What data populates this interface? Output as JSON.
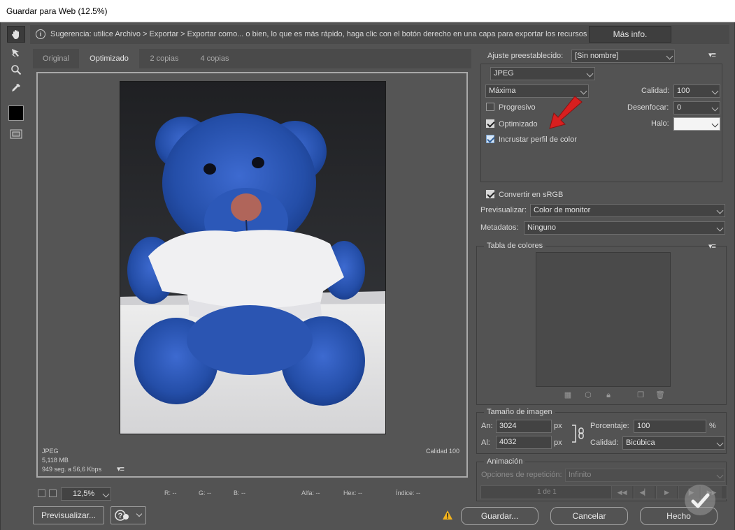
{
  "window": {
    "title": "Guardar para Web (12.5%)"
  },
  "hint": {
    "icon": "info-icon",
    "text": "Sugerencia: utilice Archivo > Exportar > Exportar como... o bien, lo que es más rápido, haga clic con el botón derecho en una capa para exportar los recursos",
    "more_info": "Más info."
  },
  "tools": [
    "hand-icon",
    "slice-select-icon",
    "zoom-icon",
    "eyedropper-icon",
    "color-swatch",
    "toggle-slices-icon"
  ],
  "tabs": [
    {
      "label": "Original",
      "active": false
    },
    {
      "label": "Optimizado",
      "active": true
    },
    {
      "label": "2 copias",
      "active": false
    },
    {
      "label": "4 copias",
      "active": false
    }
  ],
  "preview_info": {
    "format": "JPEG",
    "size": "5,118 MB",
    "time": "949 seg. a 56,6 Kbps",
    "quality": "Calidad 100"
  },
  "status": {
    "zoom": "12,5%",
    "r": "R: --",
    "g": "G: --",
    "b": "B: --",
    "alpha": "Alfa: --",
    "hex": "Hex: --",
    "index": "Índice: --"
  },
  "settings": {
    "preset_label": "Ajuste preestablecido:",
    "preset_value": "[Sin nombre]",
    "format": "JPEG",
    "quality_preset": "Máxima",
    "quality_label": "Calidad:",
    "quality_value": "100",
    "blur_label": "Desenfocar:",
    "blur_value": "0",
    "matte_label": "Halo:",
    "progressive": {
      "label": "Progresivo",
      "checked": false
    },
    "optimized": {
      "label": "Optimizado",
      "checked": true
    },
    "embed_profile": {
      "label": "Incrustar perfil de color",
      "checked": true
    },
    "convert_srgb": {
      "label": "Convertir en sRGB",
      "checked": true
    },
    "preview_label": "Previsualizar:",
    "preview_value": "Color de monitor",
    "metadata_label": "Metadatos:",
    "metadata_value": "Ninguno"
  },
  "color_table": {
    "title": "Tabla de colores"
  },
  "image_size": {
    "title": "Tamaño de imagen",
    "w_label": "An:",
    "w_value": "3024",
    "h_label": "Al:",
    "h_value": "4032",
    "unit": "px",
    "percent_label": "Porcentaje:",
    "percent_value": "100",
    "percent_unit": "%",
    "quality_label": "Calidad:",
    "quality_value": "Bicúbica"
  },
  "animation": {
    "title": "Animación",
    "loop_label": "Opciones de repetición:",
    "loop_value": "Infinito",
    "frame_counter": "1 de 1"
  },
  "buttons": {
    "preview": "Previsualizar...",
    "save": "Guardar...",
    "cancel": "Cancelar",
    "done": "Hecho"
  },
  "colors": {
    "panel": "#535353",
    "annotation_arrow": "#d81f1f",
    "accent_blue": "#2f5e98"
  }
}
